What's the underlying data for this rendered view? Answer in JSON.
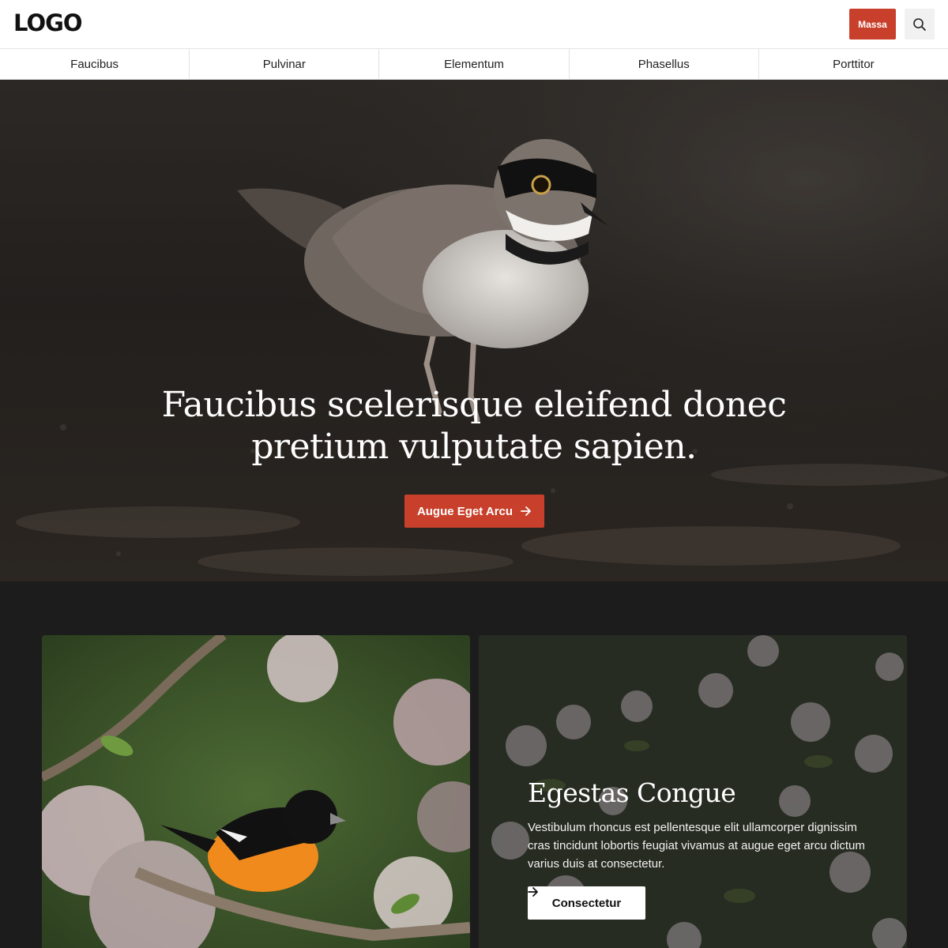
{
  "header": {
    "logo": "LOGO",
    "cta_label": "Massa",
    "search_icon": "search-icon"
  },
  "nav": {
    "items": [
      {
        "label": "Faucibus"
      },
      {
        "label": "Pulvinar"
      },
      {
        "label": "Elementum"
      },
      {
        "label": "Phasellus"
      },
      {
        "label": "Porttitor"
      }
    ]
  },
  "hero": {
    "title": "Faucibus scelerisque eleifend donec pretium vulputate sapien.",
    "button_label": "Augue Eget Arcu",
    "button_icon": "arrow-right-icon"
  },
  "feature": {
    "title": "Egestas Congue",
    "text": "Vestibulum rhoncus est pellentesque elit ullamcorper dignissim cras tincidunt lobortis feugiat vivamus at augue eget arcu dictum varius duis at consectetur.",
    "button_label": "Consectetur",
    "button_icon": "arrow-right-icon"
  },
  "colors": {
    "accent": "#c8402b",
    "dark_bg": "#1c1c1c",
    "header_bg": "#ffffff"
  }
}
